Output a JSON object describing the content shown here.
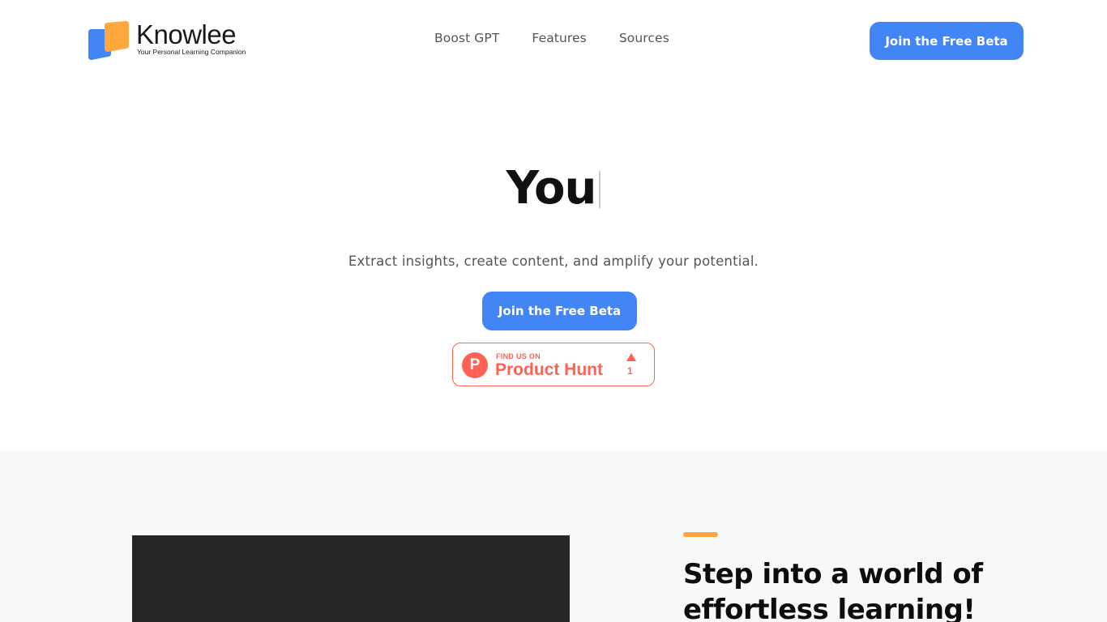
{
  "header": {
    "logo": {
      "name": "Knowlee",
      "tagline": "Your Personal Learning Companion"
    },
    "nav": [
      {
        "label": "Boost GPT"
      },
      {
        "label": "Features"
      },
      {
        "label": "Sources"
      }
    ],
    "cta_label": "Join the Free Beta"
  },
  "hero": {
    "typed_text": "You",
    "subtitle": "Extract insights, create content, and amplify your potential.",
    "cta_label": "Join the Free Beta",
    "product_hunt": {
      "find_us": "FIND US ON",
      "name": "Product Hunt",
      "logo_letter": "P",
      "upvotes": "1"
    }
  },
  "feature_section": {
    "heading": "Step into a world of effortless learning!"
  },
  "colors": {
    "primary": "#4285f4",
    "accent": "#ffa73d",
    "product_hunt": "#ff6154",
    "logo_blue": "#4285f4",
    "logo_orange": "#ffa73d"
  },
  "icons": {
    "logo": "knowlee-logo-icon",
    "product_hunt": "product-hunt-icon",
    "upvote": "upvote-arrow-icon"
  }
}
